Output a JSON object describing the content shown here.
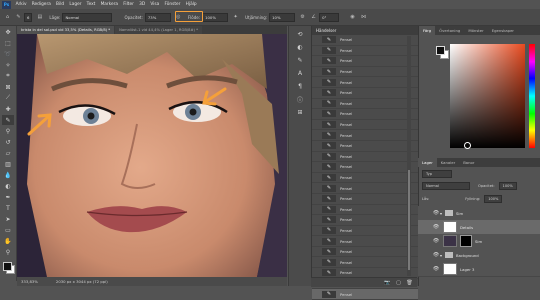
{
  "app": {
    "logo": "Ps"
  },
  "menu": [
    "Arkiv",
    "Redigera",
    "Bild",
    "Lager",
    "Text",
    "Markera",
    "Filter",
    "3D",
    "Visa",
    "Fönster",
    "Hjälp"
  ],
  "options": {
    "mode_label": "Läge:",
    "mode_value": "Normal",
    "opacity_label": "Opacitet:",
    "opacity_value": "73%",
    "flow_label": "Flöde:",
    "flow_value": "100%",
    "smoothing_label": "Utjämning:",
    "smoothing_value": "10%",
    "angle_value": "0°",
    "brush_size": "6"
  },
  "tabs": [
    {
      "label": "krista in del sol.psd vid 33,5% (Details, RGB/8) *",
      "active": true
    },
    {
      "label": "Namnlöst-1 vid 44,4% (Lager 1, RGB/8#) *",
      "active": false
    }
  ],
  "status": {
    "zoom": "333,83%",
    "doc": "2030 px x 3044 px (72 ppi)"
  },
  "history": {
    "title": "Händelser",
    "items": [
      "Pensel",
      "Pensel",
      "Pensel",
      "Pensel",
      "Pensel",
      "Pensel",
      "Pensel",
      "Pensel",
      "Pensel",
      "Pensel",
      "Pensel",
      "Pensel",
      "Pensel",
      "Pensel",
      "Pensel",
      "Pensel",
      "Pensel",
      "Pensel",
      "Pensel",
      "Pensel",
      "Pensel",
      "Pensel",
      "Pensel",
      "Pensel",
      "Pensel"
    ],
    "selected_index": 24
  },
  "color_panel": {
    "tabs": [
      "Färg",
      "Övertoning",
      "Mönster",
      "Egenskaper"
    ],
    "hue_color": "#e84a1f"
  },
  "layers": {
    "tabs": [
      "Lager",
      "Kanaler",
      "Banor"
    ],
    "filter_label": "Typ",
    "blend_mode": "Normal",
    "opacity_label": "Opacitet:",
    "opacity_value": "100%",
    "lock_label": "Lås:",
    "fill_label": "Fyllning:",
    "fill_value": "100%",
    "rows": [
      {
        "name": "Sim",
        "kind": "group"
      },
      {
        "name": "Details",
        "kind": "layer",
        "selected": true
      },
      {
        "name": "Sim",
        "kind": "masked"
      },
      {
        "name": "Background",
        "kind": "group"
      },
      {
        "name": "Lager 3",
        "kind": "layer"
      }
    ]
  },
  "colors": {
    "accent_highlight": "#f5a03a",
    "panel": "#535353",
    "selected_row": "#686868"
  }
}
